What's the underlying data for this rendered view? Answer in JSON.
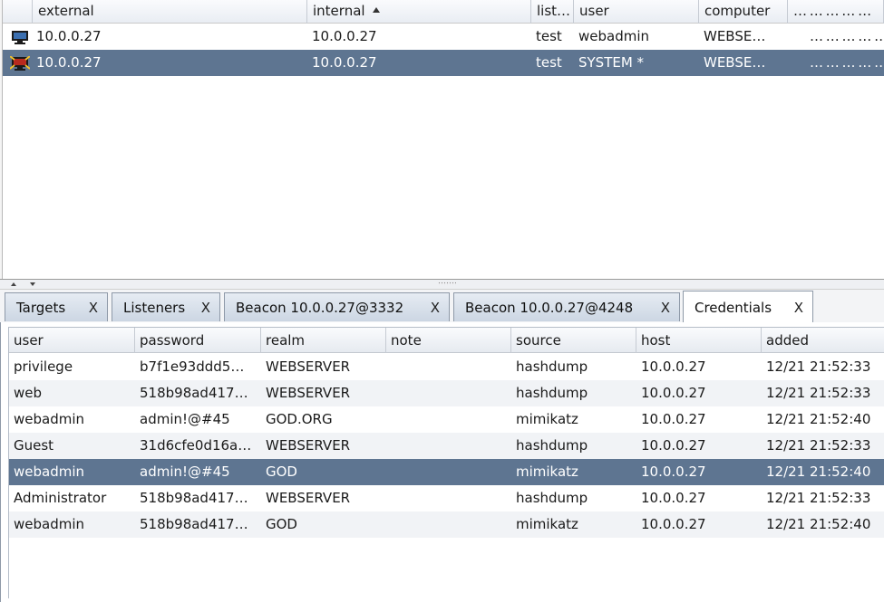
{
  "beacons": {
    "columns": [
      "external",
      "internal",
      "list…",
      "user",
      "computer",
      "… … … … …"
    ],
    "rows": [
      {
        "external": "10.0.0.27",
        "internal": "10.0.0.27",
        "listener": "test",
        "user": "webadmin",
        "computer": "WEBSE…",
        "extra": "… … … … …",
        "icon": "monitor-icon",
        "selected": false
      },
      {
        "external": "10.0.0.27",
        "internal": "10.0.0.27",
        "listener": "test",
        "user": "SYSTEM *",
        "computer": "WEBSE…",
        "extra": "… … … … …",
        "icon": "monitor-elevated-icon",
        "selected": true
      }
    ]
  },
  "tabs": [
    {
      "label": "Targets",
      "close": "X"
    },
    {
      "label": "Listeners",
      "close": "X"
    },
    {
      "label": "Beacon 10.0.0.27@3332",
      "close": "X"
    },
    {
      "label": "Beacon 10.0.0.27@4248",
      "close": "X"
    },
    {
      "label": "Credentials",
      "close": "X"
    }
  ],
  "credentials": {
    "columns": [
      "user",
      "password",
      "realm",
      "note",
      "source",
      "host",
      "added"
    ],
    "rows": [
      {
        "user": "privilege",
        "password": "b7f1e93ddd5…",
        "realm": "WEBSERVER",
        "note": "",
        "source": "hashdump",
        "host": "10.0.0.27",
        "added": "12/21 21:52:33"
      },
      {
        "user": "web",
        "password": "518b98ad417…",
        "realm": "WEBSERVER",
        "note": "",
        "source": "hashdump",
        "host": "10.0.0.27",
        "added": "12/21 21:52:33"
      },
      {
        "user": "webadmin",
        "password": "admin!@#45",
        "realm": "GOD.ORG",
        "note": "",
        "source": "mimikatz",
        "host": "10.0.0.27",
        "added": "12/21 21:52:40"
      },
      {
        "user": "Guest",
        "password": "31d6cfe0d16a…",
        "realm": "WEBSERVER",
        "note": "",
        "source": "hashdump",
        "host": "10.0.0.27",
        "added": "12/21 21:52:33"
      },
      {
        "user": "webadmin",
        "password": "admin!@#45",
        "realm": "GOD",
        "note": "",
        "source": "mimikatz",
        "host": "10.0.0.27",
        "added": "12/21 21:52:40"
      },
      {
        "user": "Administrator",
        "password": "518b98ad417…",
        "realm": "WEBSERVER",
        "note": "",
        "source": "hashdump",
        "host": "10.0.0.27",
        "added": "12/21 21:52:33"
      },
      {
        "user": "webadmin",
        "password": "518b98ad417…",
        "realm": "GOD",
        "note": "",
        "source": "mimikatz",
        "host": "10.0.0.27",
        "added": "12/21 21:52:40"
      }
    ]
  },
  "colors": {
    "selection": "#5e7591",
    "tab_active": "#ffffff",
    "tab_inactive": "#d6dfea",
    "row_alt": "#f1f3f6"
  }
}
